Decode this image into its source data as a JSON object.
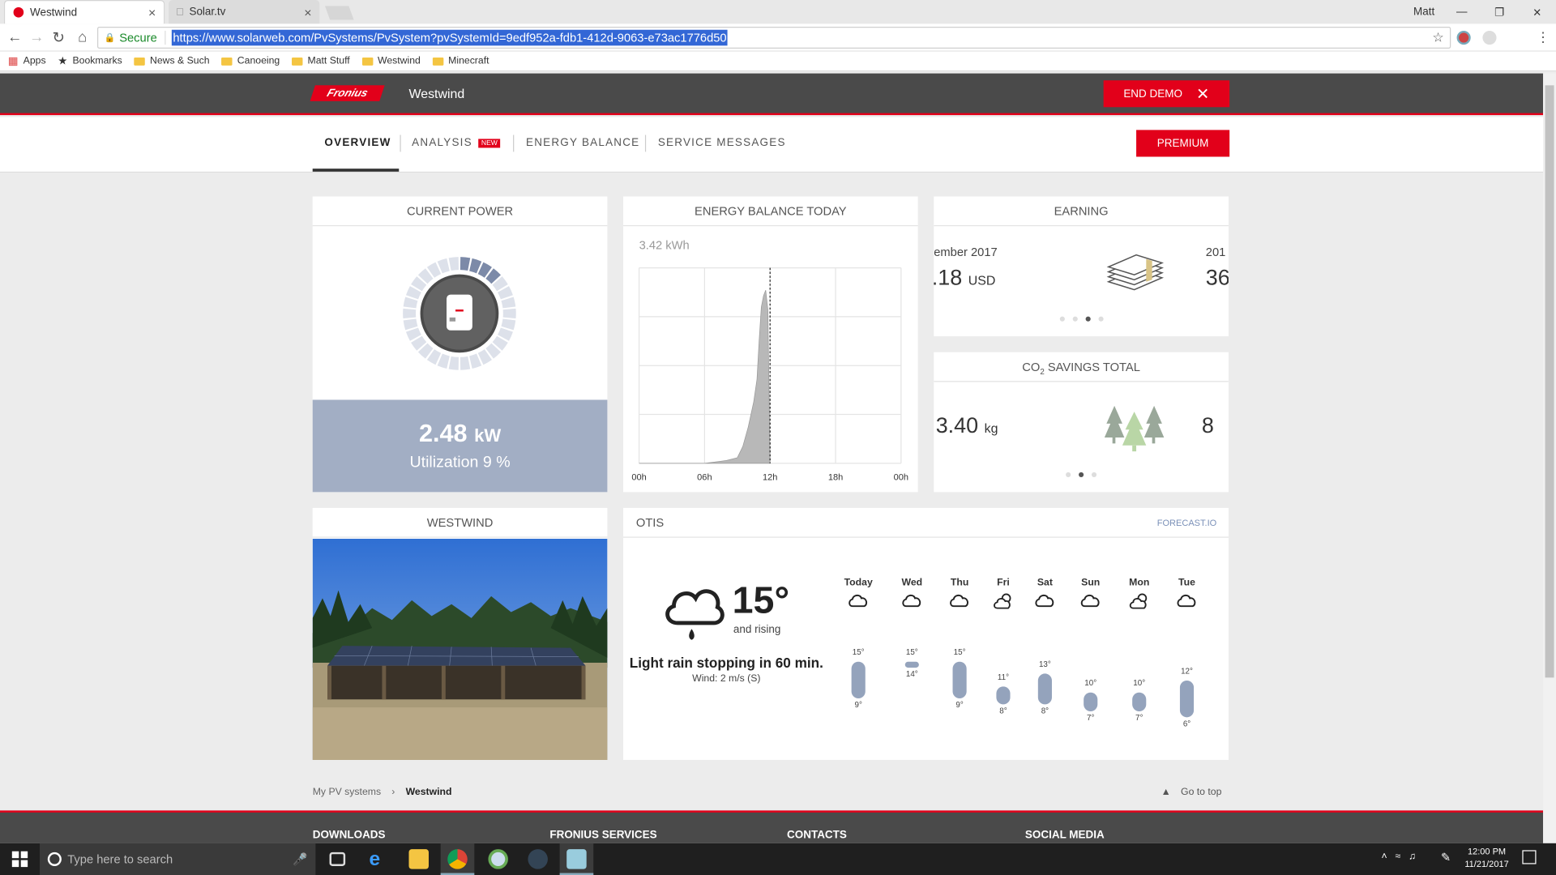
{
  "browser": {
    "tabs": [
      {
        "label": "Westwind"
      },
      {
        "label": "Solar.tv"
      }
    ],
    "profile": "Matt",
    "secure_label": "Secure",
    "url": "https://www.solarweb.com/PvSystems/PvSystem?pvSystemId=9edf952a-fdb1-412d-9063-e73ac1776d50",
    "bookmarks": [
      "Apps",
      "Bookmarks",
      "News & Such",
      "Canoeing",
      "Matt Stuff",
      "Westwind",
      "Minecraft"
    ]
  },
  "header": {
    "logo": "Fronius",
    "title": "Westwind",
    "end_demo": "END DEMO"
  },
  "nav": {
    "tabs": [
      "OVERVIEW",
      "ANALYSIS",
      "ENERGY BALANCE",
      "SERVICE MESSAGES"
    ],
    "new_badge": "NEW",
    "premium": "PREMIUM"
  },
  "current_power": {
    "title": "CURRENT POWER",
    "value": "2.48",
    "unit": "kW",
    "utilization": "Utilization 9 %",
    "utilization_fraction": 0.09
  },
  "energy_balance": {
    "title": "ENERGY BALANCE TODAY",
    "total": "3.42 kWh"
  },
  "chart_data": {
    "type": "area",
    "x_ticks": [
      "00h",
      "06h",
      "12h",
      "18h",
      "00h"
    ],
    "x_hours": [
      0,
      6,
      8,
      9,
      9.5,
      10,
      10.5,
      10.8,
      11,
      11.2,
      11.4,
      11.6,
      11.8,
      12
    ],
    "values": [
      0,
      0,
      0.1,
      0.2,
      0.6,
      1.3,
      2.2,
      3.0,
      4.4,
      5.6,
      6.0,
      6.2,
      5.5,
      0
    ],
    "now_hour": 12,
    "ylim": [
      0,
      7
    ]
  },
  "earning": {
    "title": "EARNING",
    "left_label": "ember 2017",
    "left_value": ".18",
    "currency": "USD",
    "right_label": "201",
    "right_value": "36"
  },
  "co2": {
    "title_a": "CO",
    "title_sub": "2",
    "title_b": " SAVINGS TOTAL",
    "value": "3.40",
    "unit": "kg",
    "right_value": "8"
  },
  "system_photo": {
    "title": "WESTWIND"
  },
  "weather": {
    "title": "OTIS",
    "source": "FORECAST.IO",
    "temp": "15°",
    "trend": "and rising",
    "summary": "Light rain stopping in 60 min.",
    "wind": "Wind: 2 m/s (S)",
    "days": [
      {
        "day": "Today",
        "high": "15°",
        "low": "9°",
        "icon": "cloud-icon"
      },
      {
        "day": "Wed",
        "high": "15°",
        "low": "14°",
        "icon": "cloud-icon"
      },
      {
        "day": "Thu",
        "high": "15°",
        "low": "9°",
        "icon": "cloud-icon"
      },
      {
        "day": "Fri",
        "high": "11°",
        "low": "8°",
        "icon": "partly-cloudy-icon"
      },
      {
        "day": "Sat",
        "high": "13°",
        "low": "8°",
        "icon": "cloud-icon"
      },
      {
        "day": "Sun",
        "high": "10°",
        "low": "7°",
        "icon": "cloud-icon"
      },
      {
        "day": "Mon",
        "high": "10°",
        "low": "7°",
        "icon": "partly-cloudy-icon"
      },
      {
        "day": "Tue",
        "high": "12°",
        "low": "6°",
        "icon": "cloud-icon"
      }
    ]
  },
  "breadcrumb": {
    "root": "My PV systems",
    "current": "Westwind",
    "go_top": "Go to top"
  },
  "footer": {
    "cols": [
      "DOWNLOADS",
      "FRONIUS SERVICES",
      "CONTACTS",
      "SOCIAL MEDIA"
    ]
  },
  "taskbar": {
    "search": "Type here to search",
    "time": "12:00 PM",
    "date": "11/21/2017"
  },
  "colors": {
    "brand_red": "#e2001a",
    "header_grey": "#4a4a4a",
    "power_blue": "#a2aec4"
  }
}
